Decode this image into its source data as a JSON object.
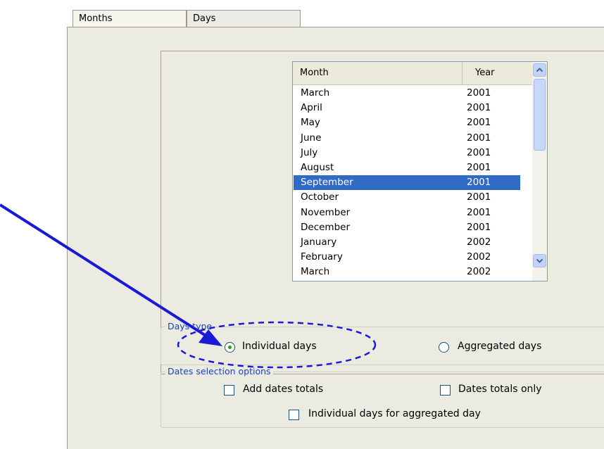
{
  "tabs": [
    {
      "label": "Months",
      "active": true
    },
    {
      "label": "Days",
      "active": false
    }
  ],
  "month_list": {
    "headers": {
      "month": "Month",
      "year": "Year"
    },
    "rows": [
      {
        "month": "March",
        "year": "2001"
      },
      {
        "month": "April",
        "year": "2001"
      },
      {
        "month": "May",
        "year": "2001"
      },
      {
        "month": "June",
        "year": "2001"
      },
      {
        "month": "July",
        "year": "2001"
      },
      {
        "month": "August",
        "year": "2001"
      },
      {
        "month": "September",
        "year": "2001",
        "selected": true
      },
      {
        "month": "October",
        "year": "2001"
      },
      {
        "month": "November",
        "year": "2001"
      },
      {
        "month": "December",
        "year": "2001"
      },
      {
        "month": "January",
        "year": "2002"
      },
      {
        "month": "February",
        "year": "2002"
      },
      {
        "month": "March",
        "year": "2002"
      }
    ]
  },
  "days_type": {
    "legend": "Days type",
    "individual_label": "Individual days",
    "aggregated_label": "Aggregated days",
    "selected": "individual"
  },
  "dates_selection": {
    "legend": "Dates selection options",
    "add_totals_label": "Add dates totals",
    "totals_only_label": "Dates totals only",
    "individual_for_aggregated_label": "Individual days for aggregated day"
  },
  "annotation": {
    "color": "#1a1ad6"
  }
}
